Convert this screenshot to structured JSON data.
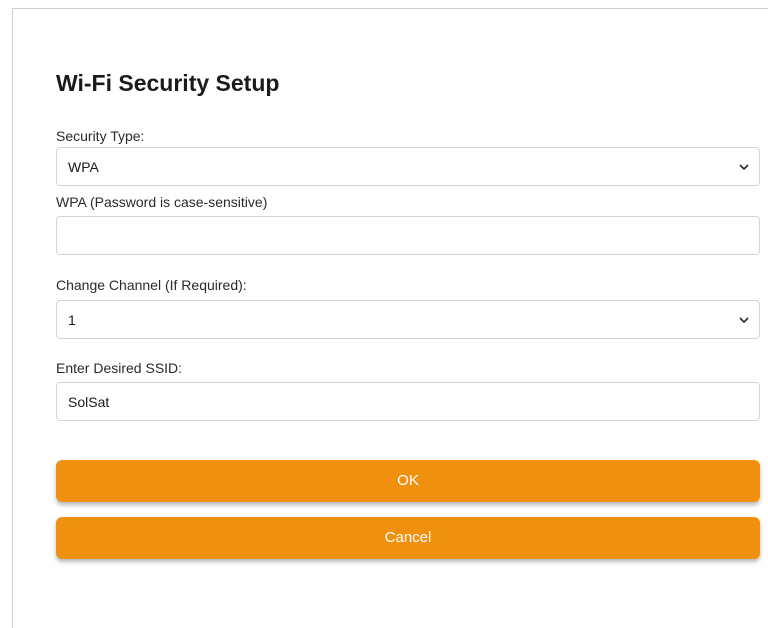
{
  "dialog": {
    "close_symbol": "×",
    "title": "Wi-Fi Security Setup"
  },
  "security": {
    "label": "Security Type:",
    "value": "WPA"
  },
  "password": {
    "label": "WPA (Password is case-sensitive)",
    "value": ""
  },
  "channel": {
    "label": "Change Channel (If Required):",
    "value": "1"
  },
  "ssid": {
    "label": "Enter Desired SSID:",
    "value": "SolSat"
  },
  "buttons": {
    "ok_label": "OK",
    "cancel_label": "Cancel"
  },
  "icons": {
    "close": "close-icon",
    "dropdown": "chevron-down-icon"
  },
  "colors": {
    "accent": "#f0900f",
    "button_text": "#ffffff"
  }
}
